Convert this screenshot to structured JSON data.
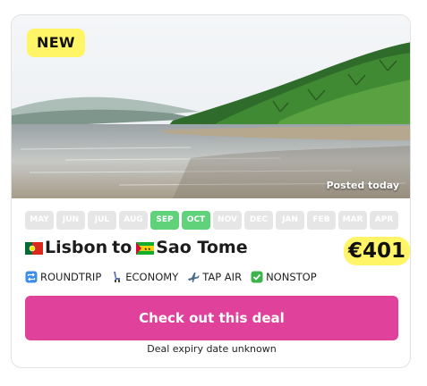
{
  "deal": {
    "badge": "NEW",
    "posted": "Posted today",
    "months": [
      {
        "label": "MAY",
        "active": false
      },
      {
        "label": "JUN",
        "active": false
      },
      {
        "label": "JUL",
        "active": false
      },
      {
        "label": "AUG",
        "active": false
      },
      {
        "label": "SEP",
        "active": true
      },
      {
        "label": "OCT",
        "active": true
      },
      {
        "label": "NOV",
        "active": false
      },
      {
        "label": "DEC",
        "active": false
      },
      {
        "label": "JAN",
        "active": false
      },
      {
        "label": "FEB",
        "active": false
      },
      {
        "label": "MAR",
        "active": false
      },
      {
        "label": "APR",
        "active": false
      }
    ],
    "origin": "Lisbon",
    "connector": "to",
    "destination": "Sao Tome",
    "origin_flag": "portugal-flag-icon",
    "destination_flag": "sao-tome-flag-icon",
    "price": "€401",
    "tags": {
      "trip": "ROUNDTRIP",
      "cabin": "ECONOMY",
      "airline": "TAP AIR",
      "stops": "NONSTOP"
    },
    "cta": "Check out this deal",
    "expiry": "Deal expiry date unknown"
  },
  "colors": {
    "highlight": "#fff566",
    "cta": "#e0419a",
    "month_active": "#5fd27a",
    "month_inactive": "#e6e6e6"
  }
}
